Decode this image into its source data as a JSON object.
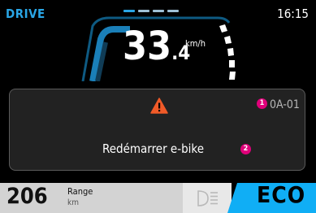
{
  "header": {
    "mode": "DRIVE",
    "clock": "16:15"
  },
  "speed": {
    "whole": "33",
    "decimal": ".4",
    "unit": "km/h"
  },
  "alert": {
    "code": "0A-01",
    "message": "Redémarrer e-bike",
    "badge1": "1",
    "badge2": "2"
  },
  "footer": {
    "range_value": "206",
    "range_label": "Range",
    "range_unit": "km",
    "assist_mode": "ECO"
  },
  "colors": {
    "accent": "#2aa6e6",
    "eco_background": "#10aef5",
    "warning": "#f05a28",
    "badge": "#e0007a"
  },
  "icons": {
    "warning": "warning-triangle-icon",
    "light": "headlight-icon"
  }
}
